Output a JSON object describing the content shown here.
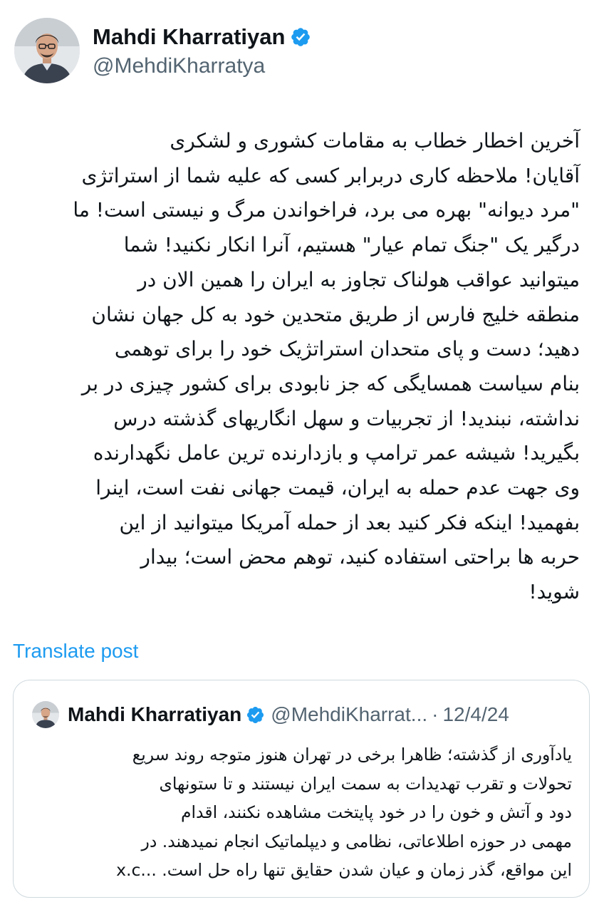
{
  "post": {
    "author": {
      "display_name": "Mahdi Kharratiyan",
      "handle": "@MehdiKharratya",
      "verified_icon": "verified-badge-icon",
      "avatar_icon": "avatar"
    },
    "text_lines": [
      "آخرین اخطار خطاب به مقامات کشوری و لشکری",
      "آقایان! ملاحظه کاری دربرابر کسی که علیه شما از استراتژی",
      "\"مرد دیوانه\" بهره می برد، فراخواندن مرگ و نیستی است! ما",
      "درگیر یک \"جنگ تمام عیار\" هستیم، آنرا انکار نکنید! شما",
      "میتوانید عواقب هولناک تجاوز به ایران را همین الان در",
      "منطقه خلیج فارس از طریق متحدین خود به کل جهان نشان",
      "دهید؛ دست و پای متحدان استراتژیک خود را برای توهمی",
      "بنام سیاست همسایگی که جز نابودی برای کشور چیزی در بر",
      "نداشته، نبندید! از تجربیات و سهل انگاریهای گذشته درس",
      "بگیرید! شیشه عمر ترامپ و بازدارنده ترین عامل نگهدارنده",
      "وی جهت عدم حمله به ایران، قیمت جهانی نفت است، اینرا",
      "بفهمید! اینکه فکر کنید بعد از حمله آمریکا میتوانید از این",
      "حربه ها براحتی استفاده کنید، توهم محض است؛ بیدار",
      "شوید!"
    ],
    "translate_label": "Translate post"
  },
  "quote": {
    "author": {
      "display_name": "Mahdi Kharratiyan",
      "handle": "@MehdiKharrat...",
      "separator": "·",
      "date": "12/4/24"
    },
    "text_lines": [
      "یادآوری از گذشته؛ ظاهرا برخی در تهران هنوز متوجه روند سریع",
      "تحولات و تقرب تهدیدات به سمت ایران نیستند و تا ستونهای",
      "دود و آتش و خون را در خود پایتخت مشاهده نکنند، اقدام",
      "مهمی در حوزه اطلاعاتی، نظامی و دیپلماتیک انجام نمیدهند. در",
      "این مواقع، گذر زمان و عیان شدن حقایق تنها راه حل است. ...x.c"
    ]
  },
  "colors": {
    "text": "#0f1419",
    "secondary": "#536471",
    "accent": "#1d9bf0",
    "border": "#cfd9de"
  }
}
